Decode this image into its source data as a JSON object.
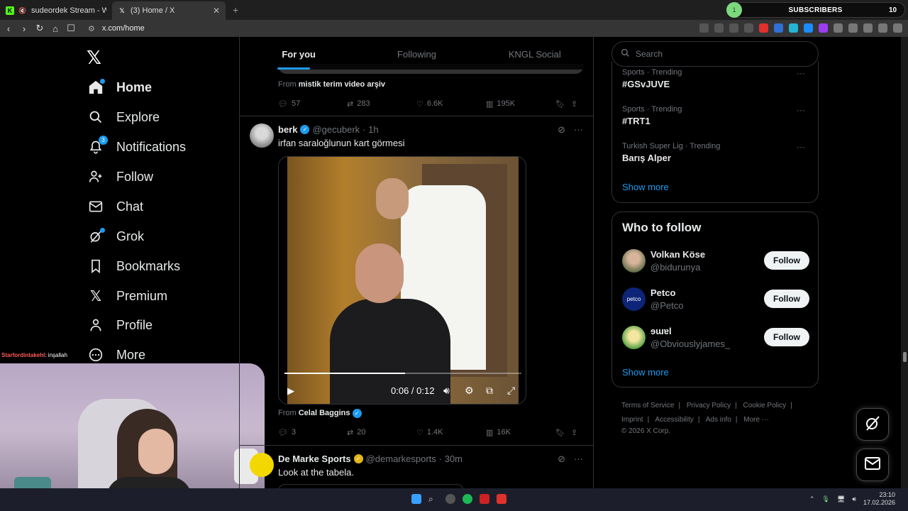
{
  "browser": {
    "tabs": [
      {
        "title": "sudeordek Stream - Watch Live o"
      },
      {
        "title": "(3) Home / X"
      }
    ],
    "url": "x.com/home",
    "subscribers_widget": {
      "dot": "1",
      "label": "SUBSCRIBERS",
      "count": "10"
    }
  },
  "nav": {
    "items": [
      {
        "label": "Home",
        "icon": "home-icon"
      },
      {
        "label": "Explore",
        "icon": "search-icon"
      },
      {
        "label": "Notifications",
        "icon": "bell-icon",
        "badge": "3"
      },
      {
        "label": "Follow",
        "icon": "person-add-icon"
      },
      {
        "label": "Chat",
        "icon": "mail-icon"
      },
      {
        "label": "Grok",
        "icon": "grok-icon"
      },
      {
        "label": "Bookmarks",
        "icon": "bookmark-icon"
      },
      {
        "label": "Premium",
        "icon": "x-logo-icon"
      },
      {
        "label": "Profile",
        "icon": "person-icon"
      },
      {
        "label": "More",
        "icon": "more-circle-icon"
      }
    ]
  },
  "stream_chat": {
    "name": "Starfordintakehl",
    "message": ": inşallah"
  },
  "timeline": {
    "tabs": [
      "For you",
      "Following",
      "KNGL Social"
    ],
    "prev_tweet": {
      "from_prefix": "From",
      "from_name": "mistik terim video arşiv",
      "replies": "57",
      "reposts": "283",
      "likes": "6.6K",
      "views": "195K"
    },
    "tweet1": {
      "name": "berk",
      "handle": "@gecuberk",
      "time": "· 1h",
      "text": "irfan saraloğlunun kart görmesi",
      "video_time": "0:06 / 0:12",
      "from_prefix": "From",
      "from_name": "Celal Baggins",
      "replies": "3",
      "reposts": "20",
      "likes": "1.4K",
      "views": "16K"
    },
    "tweet2": {
      "name": "De Marke Sports",
      "handle": "@demarkesports",
      "time": "· 30m",
      "text": "Look at the tabela."
    }
  },
  "right": {
    "search_placeholder": "Search",
    "trends": [
      {
        "category": "Sports · Trending",
        "name": "#GSvJUVE"
      },
      {
        "category": "Sports · Trending",
        "name": "#TRT1"
      },
      {
        "category": "Turkish Super Lig · Trending",
        "name": "Barış Alper"
      }
    ],
    "show_more": "Show more",
    "who_to_follow": {
      "title": "Who to follow",
      "accounts": [
        {
          "name": "Volkan Köse",
          "handle": "@bidurunya",
          "button": "Follow"
        },
        {
          "name": "Petco",
          "handle": "@Petco",
          "button": "Follow",
          "avatar_text": "petco"
        },
        {
          "name": "ɘɯɐl",
          "handle": "@Obviouslyjames_",
          "button": "Follow"
        }
      ],
      "show_more": "Show more"
    },
    "footer": {
      "links_row1": [
        "Terms of Service",
        "|",
        "Privacy Policy",
        "|",
        "Cookie Policy",
        "|"
      ],
      "links_row2": [
        "Imprint",
        "|",
        "Accessibility",
        "|",
        "Ads info",
        "|",
        "More ···"
      ],
      "copyright": "© 2026 X Corp."
    }
  },
  "taskbar": {
    "time": "23:10",
    "date": "17.02.2026"
  },
  "colors": {
    "accent": "#1d9bf0",
    "background": "#000000",
    "border": "#2f3336",
    "muted": "#71767b"
  }
}
